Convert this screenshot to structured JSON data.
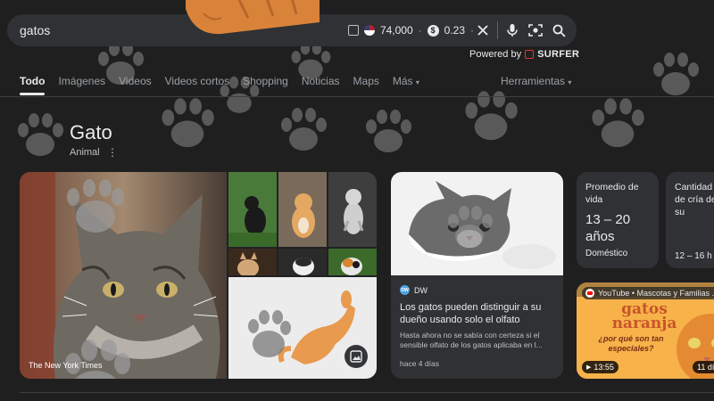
{
  "search": {
    "query": "gatos",
    "stats": {
      "count": "74,000",
      "price": "0.23"
    }
  },
  "powered_by": {
    "label": "Powered by",
    "brand": "SURFER"
  },
  "tabs": [
    {
      "label": "Todo",
      "active": true
    },
    {
      "label": "Imágenes"
    },
    {
      "label": "Videos"
    },
    {
      "label": "Videos cortos"
    },
    {
      "label": "Shopping"
    },
    {
      "label": "Noticias"
    },
    {
      "label": "Maps"
    },
    {
      "label": "Más"
    }
  ],
  "tools_label": "Herramientas",
  "knowledge": {
    "title": "Gato",
    "subtitle": "Animal"
  },
  "images": {
    "main_caption": "The New York Times"
  },
  "news": {
    "source": "DW",
    "source_logo": "DW",
    "title": "Los gatos pueden distinguir a su dueño usando solo el olfato",
    "snippet": "Hasta ahora no se sabía con certeza si el sensible olfato de los gatos aplicaba en l...",
    "time": "hace 4 días"
  },
  "info_cards": [
    {
      "label": "Promedio de vida",
      "value": "13 – 20 años",
      "note": "Doméstico"
    },
    {
      "label": "Cantidad de cría de su",
      "value": "",
      "note": "12 – 16 h"
    }
  ],
  "video": {
    "channel": "YouTube • Mascotas y Familias ...",
    "thumb_title": "gatos naranja",
    "thumb_sub": "¿por qué son tan especiales?",
    "duration": "13:55",
    "duration2": "11 dí"
  },
  "colors": {
    "background": "#1f1f1f",
    "surface": "#303134",
    "text": "#e8eaed",
    "muted": "#9aa0a6",
    "surfer_red": "#e8372b"
  }
}
